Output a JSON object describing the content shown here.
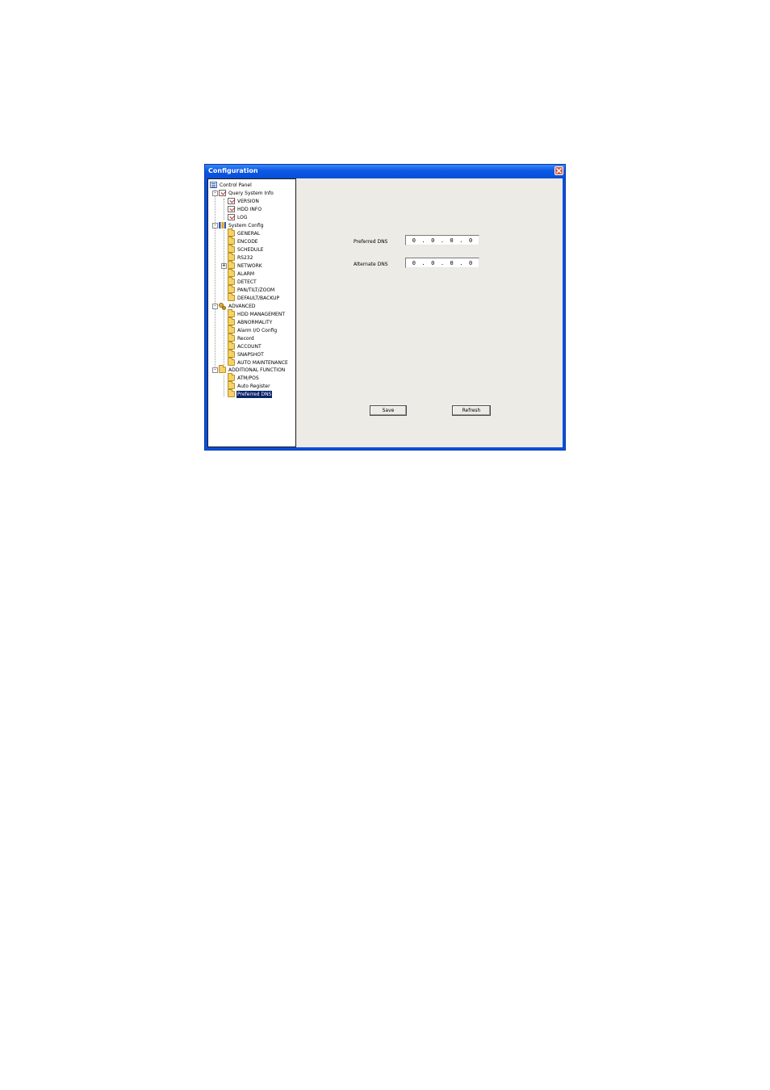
{
  "window": {
    "title": "Configuration"
  },
  "tree": {
    "root": "Control Panel",
    "query_system_info": {
      "label": "Query System Info",
      "children": [
        "VERSION",
        "HDD INFO",
        "LOG"
      ]
    },
    "system_config": {
      "label": "System Config",
      "children": [
        "GENERAL",
        "ENCODE",
        "SCHEDULE",
        "RS232",
        "NETWORK",
        "ALARM",
        "DETECT",
        "PAN/TILT/ZOOM",
        "DEFAULT/BACKUP"
      ]
    },
    "advanced": {
      "label": "ADVANCED",
      "children": [
        "HDD MANAGEMENT",
        "ABNORMALITY",
        "Alarm I/O Config",
        "Record",
        "ACCOUNT",
        "SNAPSHOT",
        "AUTO MAINTENANCE"
      ]
    },
    "additional_function": {
      "label": "ADDITIONAL FUNCTION",
      "children": [
        "ATM/POS",
        "Auto Register",
        "Preferred DNS"
      ]
    },
    "selected": "Preferred DNS"
  },
  "form": {
    "preferred_dns": {
      "label": "Preferred DNS",
      "octets": [
        "0",
        "0",
        "0",
        "0"
      ]
    },
    "alternate_dns": {
      "label": "Alternate DNS",
      "octets": [
        "0",
        "0",
        "0",
        "0"
      ]
    },
    "save_label": "Save",
    "refresh_label": "Refresh"
  }
}
